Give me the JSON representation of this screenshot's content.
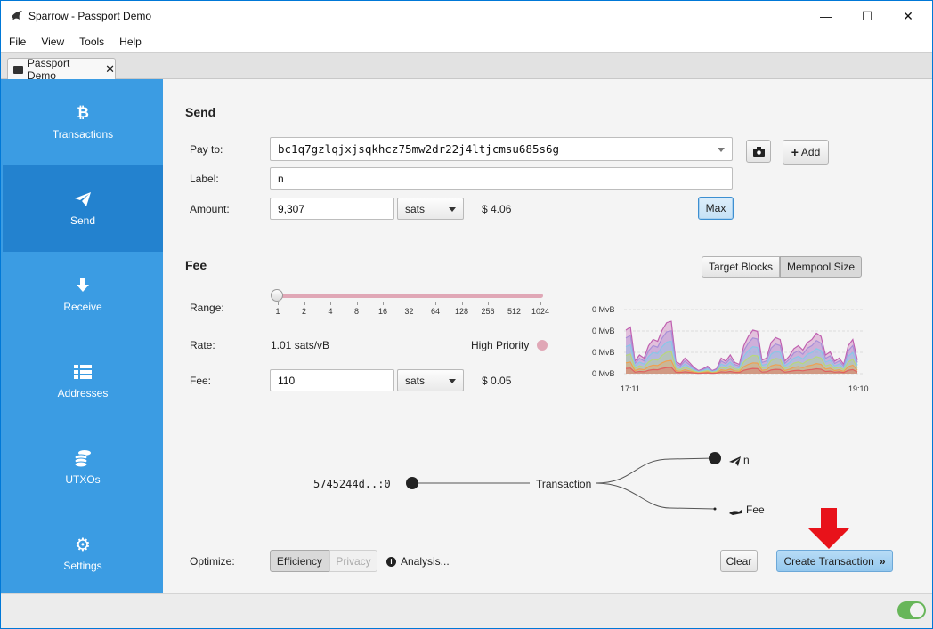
{
  "window": {
    "title": "Sparrow - Passport Demo",
    "minimize": "—",
    "maximize": "☐",
    "close": "✕"
  },
  "menu": [
    "File",
    "View",
    "Tools",
    "Help"
  ],
  "doc_tab": {
    "label": "Passport Demo",
    "close": "✕"
  },
  "sidebar": {
    "items": [
      {
        "label": "Transactions",
        "icon": "bitcoin-icon"
      },
      {
        "label": "Send",
        "icon": "paper-plane-icon",
        "active": true
      },
      {
        "label": "Receive",
        "icon": "arrow-down-icon"
      },
      {
        "label": "Addresses",
        "icon": "list-icon"
      },
      {
        "label": "UTXOs",
        "icon": "coins-icon"
      },
      {
        "label": "Settings",
        "icon": "gear-icon"
      }
    ]
  },
  "send": {
    "title": "Send",
    "pay_to_label": "Pay to:",
    "pay_to_value": "bc1q7gzlqjxjsqkhcz75mw2dr22j4ltjcmsu685s6g",
    "add_label": "Add",
    "label_label": "Label:",
    "label_value": "n",
    "amount_label": "Amount:",
    "amount_value": "9,307",
    "amount_unit": "sats",
    "amount_fiat": "$ 4.06",
    "max_label": "Max"
  },
  "fee": {
    "title": "Fee",
    "target_blocks_label": "Target Blocks",
    "mempool_size_label": "Mempool Size",
    "range_label": "Range:",
    "range_ticks": [
      "1",
      "2",
      "4",
      "8",
      "16",
      "32",
      "64",
      "128",
      "256",
      "512",
      "1024"
    ],
    "range_value": 0,
    "rate_label": "Rate:",
    "rate_value": "1.01 sats/vB",
    "priority_label": "High Priority",
    "fee_label": "Fee:",
    "fee_value": "110",
    "fee_unit": "sats",
    "fee_fiat": "$ 0.05"
  },
  "mempool_chart": {
    "y_ticks": [
      "0 MvB",
      "0 MvB",
      "0 MvB",
      "0 MvB"
    ],
    "x_start": "17:11",
    "x_end": "19:10",
    "colors": [
      "#e06060",
      "#f0a050",
      "#b8d87a",
      "#88c8e8",
      "#a890d8",
      "#c060b0"
    ]
  },
  "diagram": {
    "input": "5745244d..:0",
    "center": "Transaction",
    "outputs": [
      {
        "label": "n",
        "icon": "paper-plane-icon"
      },
      {
        "label": "Fee",
        "icon": "hand-coin-icon"
      }
    ]
  },
  "bottom": {
    "optimize_label": "Optimize:",
    "efficiency_label": "Efficiency",
    "privacy_label": "Privacy",
    "analysis_label": "Analysis...",
    "clear_label": "Clear",
    "create_label": "Create Transaction",
    "create_suffix": "»"
  },
  "colors": {
    "sidebar": "#3b9ce3",
    "sidebar_active": "#2382cf",
    "annotation_arrow": "#e8121a",
    "toggle_on": "#68b65a"
  }
}
